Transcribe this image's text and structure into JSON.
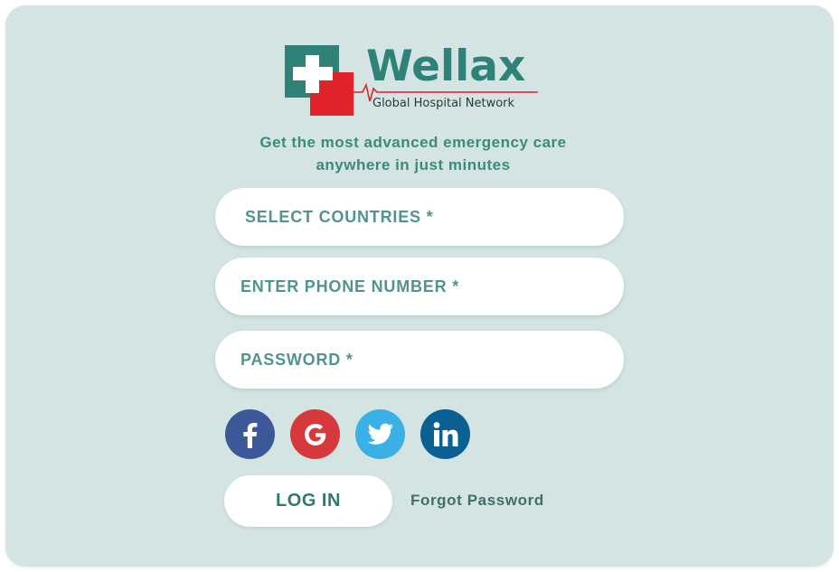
{
  "logo": {
    "brand": "Wellax",
    "subtitle": "Global Hospital Network"
  },
  "tagline": {
    "line1": "Get the most advanced emergency care",
    "line2": "anywhere in just minutes"
  },
  "form": {
    "country_placeholder": "SELECT COUNTRIES *",
    "phone_placeholder": "ENTER PHONE NUMBER *",
    "password_placeholder": "PASSWORD *"
  },
  "social": [
    {
      "icon": "facebook-icon",
      "color": "#3b5998"
    },
    {
      "icon": "google-icon",
      "color": "#d6393b"
    },
    {
      "icon": "twitter-icon",
      "color": "#3ab0e6"
    },
    {
      "icon": "linkedin-icon",
      "color": "#0a6093"
    }
  ],
  "actions": {
    "login_label": "LOG IN",
    "forgot_label": "Forgot Password"
  },
  "colors": {
    "background": "#d3e4e3",
    "brand_teal": "#2e8277",
    "brand_red": "#e0222a"
  }
}
